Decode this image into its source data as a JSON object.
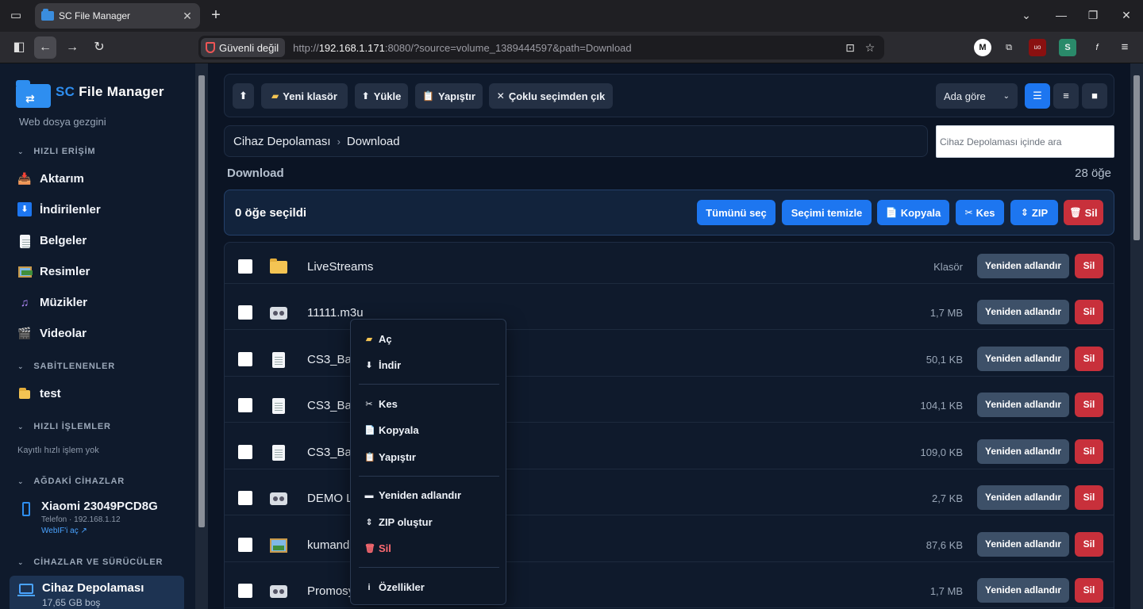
{
  "browser": {
    "tab_title": "SC File Manager",
    "security_label": "Güvenli değil",
    "url_prefix": "http://",
    "url_host": "192.168.1.171",
    "url_rest": ":8080/?source=volume_1389444597&path=Download"
  },
  "sidebar": {
    "brand_sc": "SC",
    "brand_name": "File Manager",
    "subtitle": "Web dosya gezgini",
    "quick_access_title": "HIZLI ERİŞİM",
    "quick_access": [
      {
        "label": "Aktarım",
        "icon": "transfer-icon"
      },
      {
        "label": "İndirilenler",
        "icon": "download-icon"
      },
      {
        "label": "Belgeler",
        "icon": "document-icon"
      },
      {
        "label": "Resimler",
        "icon": "picture-icon"
      },
      {
        "label": "Müzikler",
        "icon": "music-icon"
      },
      {
        "label": "Videolar",
        "icon": "video-icon"
      }
    ],
    "pinned_title": "SABİTLENENLER",
    "pinned": [
      {
        "label": "test",
        "icon": "folder-icon"
      }
    ],
    "quick_ops_title": "HIZLI İŞLEMLER",
    "quick_ops_empty": "Kayıtlı hızlı işlem yok",
    "network_title": "AĞDAKİ CİHAZLAR",
    "device": {
      "name": "Xiaomi 23049PCD8G",
      "meta": "Telefon · 192.168.1.12",
      "link": "WebIF'i aç ↗"
    },
    "drives_title": "CİHAZLAR VE SÜRÜCÜLER",
    "storage": {
      "name": "Cihaz Depolaması",
      "free": "17,65 GB boş"
    }
  },
  "toolbar": {
    "up": "⬆",
    "new_folder": "Yeni klasör",
    "upload": "Yükle",
    "paste": "Yapıştır",
    "exit_multi": "Çoklu seçimden çık",
    "sort": "Ada göre"
  },
  "breadcrumb": {
    "root": "Cihaz Depolaması",
    "current": "Download"
  },
  "search": {
    "placeholder": "Cihaz Depolaması içinde ara"
  },
  "folder": {
    "label": "Download",
    "count": "28 öğe"
  },
  "selection": {
    "label": "0 öğe seçildi",
    "select_all": "Tümünü seç",
    "clear": "Seçimi temizle",
    "copy": "Kopyala",
    "cut": "Kes",
    "zip": "ZIP",
    "delete": "Sil"
  },
  "files": [
    {
      "name": "LiveStreams",
      "size": "Klasör",
      "type": "folder"
    },
    {
      "name": "11111.m3u",
      "size": "1,7 MB",
      "type": "radio"
    },
    {
      "name": "CS3_Ba",
      "size": "50,1 KB",
      "type": "doc"
    },
    {
      "name": "CS3_Ba",
      "size": "104,1 KB",
      "type": "doc"
    },
    {
      "name": "CS3_Ba",
      "size": "109,0 KB",
      "type": "doc"
    },
    {
      "name": "DEMO L",
      "size": "2,7 KB",
      "type": "radio"
    },
    {
      "name": "kumanda",
      "size": "87,6 KB",
      "type": "pic"
    },
    {
      "name": "Promosy",
      "size": "1,7 MB",
      "type": "radio"
    }
  ],
  "row_actions": {
    "rename": "Yeniden adlandır",
    "delete": "Sil"
  },
  "context_menu": {
    "open": "Aç",
    "download": "İndir",
    "cut": "Kes",
    "copy": "Kopyala",
    "paste": "Yapıştır",
    "rename": "Yeniden adlandır",
    "zip": "ZIP oluştur",
    "delete": "Sil",
    "properties": "Özellikler"
  },
  "colors": {
    "accent": "#1d76f0",
    "danger": "#c8303b",
    "background": "#0b1424"
  }
}
